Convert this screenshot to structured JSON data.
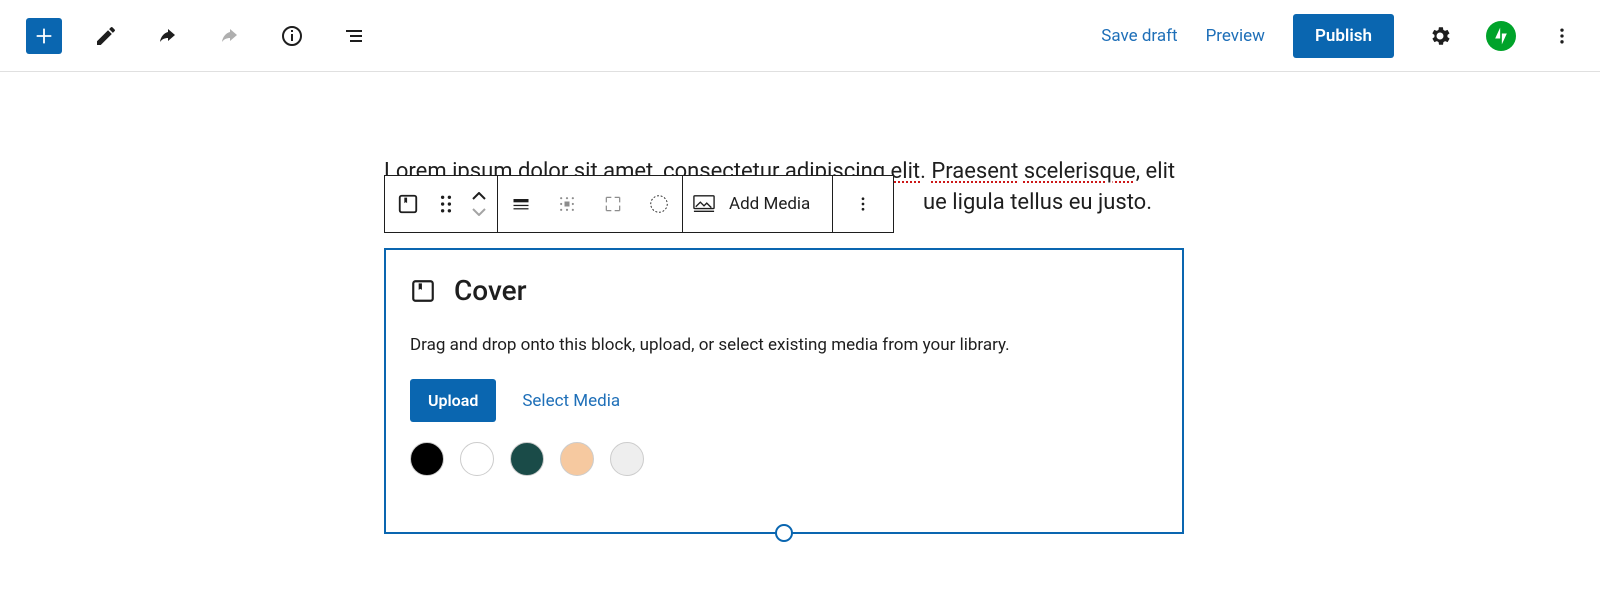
{
  "topbar": {
    "save_draft": "Save draft",
    "preview": "Preview",
    "publish": "Publish"
  },
  "paragraph": {
    "t1": "Lorem ipsum dolor sit ",
    "s1": "amet",
    ", ": ", ",
    "s2": "consectetur",
    "sp": " ",
    "s3": "adipiscing",
    "sp2": " ",
    "s4": "elit",
    "t2": ". ",
    "s5": "Praesent",
    "sp3": " ",
    "s6": "scelerisque",
    "t3": ", elit",
    "line2_tail": "ue ligula tellus eu justo."
  },
  "block_toolbar": {
    "add_media": "Add Media"
  },
  "cover": {
    "title": "Cover",
    "description": "Drag and drop onto this block, upload, or select existing media from your library.",
    "upload": "Upload",
    "select_media": "Select Media",
    "swatches": [
      "#000000",
      "#ffffff",
      "#1a4b48",
      "#f6c9a0",
      "#eeeeee"
    ]
  }
}
